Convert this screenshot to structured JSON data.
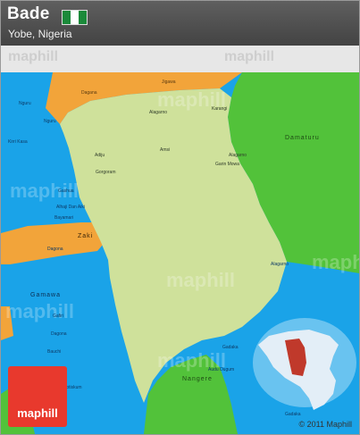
{
  "header": {
    "title": "Bade",
    "subtitle": "Yobe, Nigeria",
    "flag_colors": [
      "#1b8a3a",
      "#ffffff",
      "#1b8a3a"
    ]
  },
  "map": {
    "colors": {
      "water": "#1aa3e8",
      "selected_region": "#cfe19b",
      "neighbor_green": "#52c23a",
      "neighbor_orange": "#f2a43a",
      "inset_land": "#e3eef7",
      "inset_highlight": "#c0392b"
    },
    "regions": [
      "Damaturu",
      "Zaki",
      "Gamawa",
      "Nangere"
    ],
    "places": [
      "Jigawa",
      "Nguru",
      "Nguru",
      "Kirri Kasa",
      "Dagana",
      "Alagarno",
      "Karangi",
      "Adiju",
      "Gorgoram",
      "Amsi",
      "Alagarno",
      "Garin Mowa",
      "Gashua",
      "Alhaji Dan Aiki",
      "Bayamari",
      "Alagarno",
      "Dagona",
      "Gafiri",
      "Dagona",
      "Bauchi",
      "Gadaka",
      "Gadaka",
      "Audu Dugum",
      "Potiskum"
    ]
  },
  "watermarks": [
    "maphill",
    "maphill",
    "maphill",
    "maphill",
    "maphill",
    "maphill",
    "maphill",
    "maphill"
  ],
  "logo": {
    "text": "maphill"
  },
  "copyright": "© 2011 Maphill"
}
